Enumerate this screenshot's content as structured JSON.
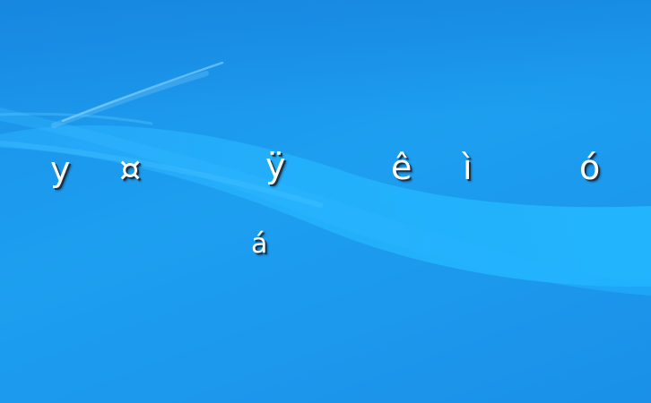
{
  "background": {
    "colors": {
      "base": "#1a8fe6",
      "wave_light": "#2bb2ff",
      "streak": "#7fd3ff"
    }
  },
  "glyphs": [
    {
      "id": "g1",
      "text": "y"
    },
    {
      "id": "g2",
      "text": "¤"
    },
    {
      "id": "g3",
      "text": "ÿ"
    },
    {
      "id": "g4",
      "text": "ê"
    },
    {
      "id": "g5",
      "text": "ì"
    },
    {
      "id": "g6",
      "text": "ó"
    },
    {
      "id": "g7",
      "text": "á"
    }
  ]
}
